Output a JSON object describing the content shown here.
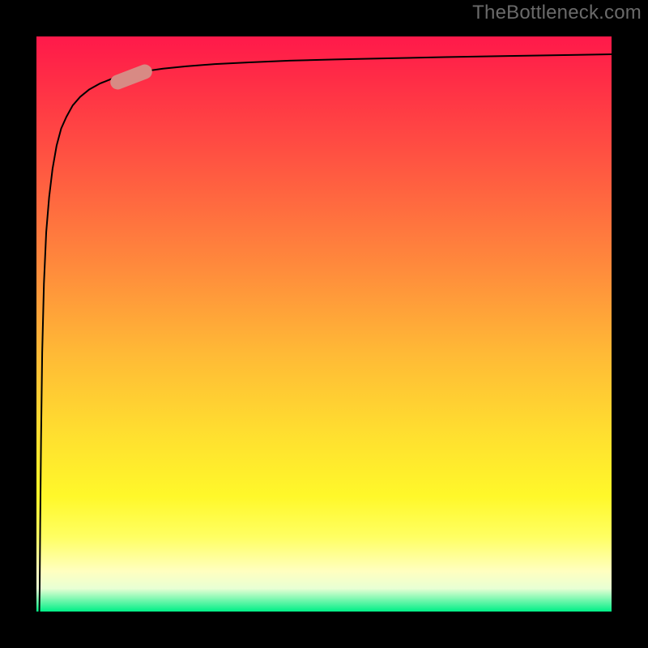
{
  "watermark": {
    "text": "TheBottleneck.com"
  },
  "chart_data": {
    "type": "line",
    "title": "",
    "xlabel": "",
    "ylabel": "",
    "xlim": [
      0,
      100
    ],
    "ylim": [
      0,
      100
    ],
    "grid": false,
    "gradient_stops": [
      {
        "pos": 0,
        "color": "#ff194a"
      },
      {
        "pos": 8,
        "color": "#ff2e46"
      },
      {
        "pos": 24,
        "color": "#ff5b41"
      },
      {
        "pos": 40,
        "color": "#ff8a3c"
      },
      {
        "pos": 55,
        "color": "#ffb936"
      },
      {
        "pos": 70,
        "color": "#ffe12f"
      },
      {
        "pos": 80,
        "color": "#fff82a"
      },
      {
        "pos": 87,
        "color": "#ffff62"
      },
      {
        "pos": 93,
        "color": "#ffffc0"
      },
      {
        "pos": 96,
        "color": "#e8ffd4"
      },
      {
        "pos": 100,
        "color": "#00ef87"
      }
    ],
    "series": [
      {
        "name": "curve",
        "color": "#000000",
        "stroke_width": 2,
        "x": [
          0.5,
          0.56,
          0.65,
          0.8,
          1.0,
          1.3,
          1.7,
          2.2,
          2.8,
          3.5,
          4.3,
          5.2,
          6.3,
          7.6,
          9.2,
          11,
          13,
          15.5,
          18.5,
          22,
          26,
          31,
          37,
          44,
          52,
          61,
          71,
          82,
          94,
          100
        ],
        "y": [
          0,
          4,
          15,
          30,
          45,
          57,
          66,
          72,
          77,
          81,
          84,
          86,
          88,
          89.5,
          90.8,
          91.8,
          92.6,
          93.3,
          93.9,
          94.4,
          94.8,
          95.2,
          95.5,
          95.8,
          96.0,
          96.2,
          96.4,
          96.6,
          96.8,
          96.9
        ]
      }
    ],
    "marker": {
      "x": 16.5,
      "y": 92.9,
      "angle_deg": -21,
      "color": "#d88a84"
    }
  }
}
